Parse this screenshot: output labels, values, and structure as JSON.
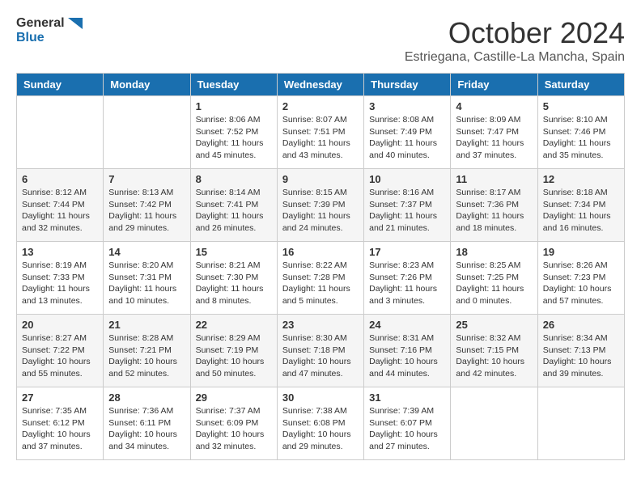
{
  "header": {
    "logo_general": "General",
    "logo_blue": "Blue",
    "month_title": "October 2024",
    "location": "Estriegana, Castille-La Mancha, Spain"
  },
  "days_of_week": [
    "Sunday",
    "Monday",
    "Tuesday",
    "Wednesday",
    "Thursday",
    "Friday",
    "Saturday"
  ],
  "weeks": [
    [
      {
        "day": "",
        "detail": ""
      },
      {
        "day": "",
        "detail": ""
      },
      {
        "day": "1",
        "detail": "Sunrise: 8:06 AM\nSunset: 7:52 PM\nDaylight: 11 hours and 45 minutes."
      },
      {
        "day": "2",
        "detail": "Sunrise: 8:07 AM\nSunset: 7:51 PM\nDaylight: 11 hours and 43 minutes."
      },
      {
        "day": "3",
        "detail": "Sunrise: 8:08 AM\nSunset: 7:49 PM\nDaylight: 11 hours and 40 minutes."
      },
      {
        "day": "4",
        "detail": "Sunrise: 8:09 AM\nSunset: 7:47 PM\nDaylight: 11 hours and 37 minutes."
      },
      {
        "day": "5",
        "detail": "Sunrise: 8:10 AM\nSunset: 7:46 PM\nDaylight: 11 hours and 35 minutes."
      }
    ],
    [
      {
        "day": "6",
        "detail": "Sunrise: 8:12 AM\nSunset: 7:44 PM\nDaylight: 11 hours and 32 minutes."
      },
      {
        "day": "7",
        "detail": "Sunrise: 8:13 AM\nSunset: 7:42 PM\nDaylight: 11 hours and 29 minutes."
      },
      {
        "day": "8",
        "detail": "Sunrise: 8:14 AM\nSunset: 7:41 PM\nDaylight: 11 hours and 26 minutes."
      },
      {
        "day": "9",
        "detail": "Sunrise: 8:15 AM\nSunset: 7:39 PM\nDaylight: 11 hours and 24 minutes."
      },
      {
        "day": "10",
        "detail": "Sunrise: 8:16 AM\nSunset: 7:37 PM\nDaylight: 11 hours and 21 minutes."
      },
      {
        "day": "11",
        "detail": "Sunrise: 8:17 AM\nSunset: 7:36 PM\nDaylight: 11 hours and 18 minutes."
      },
      {
        "day": "12",
        "detail": "Sunrise: 8:18 AM\nSunset: 7:34 PM\nDaylight: 11 hours and 16 minutes."
      }
    ],
    [
      {
        "day": "13",
        "detail": "Sunrise: 8:19 AM\nSunset: 7:33 PM\nDaylight: 11 hours and 13 minutes."
      },
      {
        "day": "14",
        "detail": "Sunrise: 8:20 AM\nSunset: 7:31 PM\nDaylight: 11 hours and 10 minutes."
      },
      {
        "day": "15",
        "detail": "Sunrise: 8:21 AM\nSunset: 7:30 PM\nDaylight: 11 hours and 8 minutes."
      },
      {
        "day": "16",
        "detail": "Sunrise: 8:22 AM\nSunset: 7:28 PM\nDaylight: 11 hours and 5 minutes."
      },
      {
        "day": "17",
        "detail": "Sunrise: 8:23 AM\nSunset: 7:26 PM\nDaylight: 11 hours and 3 minutes."
      },
      {
        "day": "18",
        "detail": "Sunrise: 8:25 AM\nSunset: 7:25 PM\nDaylight: 11 hours and 0 minutes."
      },
      {
        "day": "19",
        "detail": "Sunrise: 8:26 AM\nSunset: 7:23 PM\nDaylight: 10 hours and 57 minutes."
      }
    ],
    [
      {
        "day": "20",
        "detail": "Sunrise: 8:27 AM\nSunset: 7:22 PM\nDaylight: 10 hours and 55 minutes."
      },
      {
        "day": "21",
        "detail": "Sunrise: 8:28 AM\nSunset: 7:21 PM\nDaylight: 10 hours and 52 minutes."
      },
      {
        "day": "22",
        "detail": "Sunrise: 8:29 AM\nSunset: 7:19 PM\nDaylight: 10 hours and 50 minutes."
      },
      {
        "day": "23",
        "detail": "Sunrise: 8:30 AM\nSunset: 7:18 PM\nDaylight: 10 hours and 47 minutes."
      },
      {
        "day": "24",
        "detail": "Sunrise: 8:31 AM\nSunset: 7:16 PM\nDaylight: 10 hours and 44 minutes."
      },
      {
        "day": "25",
        "detail": "Sunrise: 8:32 AM\nSunset: 7:15 PM\nDaylight: 10 hours and 42 minutes."
      },
      {
        "day": "26",
        "detail": "Sunrise: 8:34 AM\nSunset: 7:13 PM\nDaylight: 10 hours and 39 minutes."
      }
    ],
    [
      {
        "day": "27",
        "detail": "Sunrise: 7:35 AM\nSunset: 6:12 PM\nDaylight: 10 hours and 37 minutes."
      },
      {
        "day": "28",
        "detail": "Sunrise: 7:36 AM\nSunset: 6:11 PM\nDaylight: 10 hours and 34 minutes."
      },
      {
        "day": "29",
        "detail": "Sunrise: 7:37 AM\nSunset: 6:09 PM\nDaylight: 10 hours and 32 minutes."
      },
      {
        "day": "30",
        "detail": "Sunrise: 7:38 AM\nSunset: 6:08 PM\nDaylight: 10 hours and 29 minutes."
      },
      {
        "day": "31",
        "detail": "Sunrise: 7:39 AM\nSunset: 6:07 PM\nDaylight: 10 hours and 27 minutes."
      },
      {
        "day": "",
        "detail": ""
      },
      {
        "day": "",
        "detail": ""
      }
    ]
  ]
}
